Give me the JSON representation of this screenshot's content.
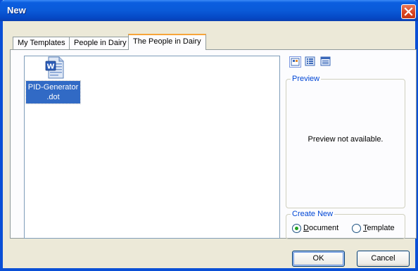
{
  "window": {
    "title": "New"
  },
  "tabs": [
    {
      "label": "My Templates",
      "active": false
    },
    {
      "label": "People in Dairy",
      "active": false
    },
    {
      "label": "The People in Dairy",
      "active": true
    }
  ],
  "files": [
    {
      "name_line1": "PID-Generator",
      "name_line2": ".dot",
      "icon": "word-template-icon",
      "selected": true
    }
  ],
  "view_buttons": [
    "large-icons-icon",
    "list-icon",
    "details-icon"
  ],
  "preview": {
    "legend": "Preview",
    "message": "Preview not available."
  },
  "create_new": {
    "legend": "Create New",
    "options": [
      {
        "label_first": "D",
        "label_rest": "ocument",
        "checked": true
      },
      {
        "label_first": "T",
        "label_rest": "emplate",
        "checked": false
      }
    ]
  },
  "buttons": {
    "ok": "OK",
    "cancel": "Cancel"
  },
  "colors": {
    "titlebar": "#0a5ad8",
    "selection": "#316ac5",
    "tab_highlight": "#f7a53a",
    "legend": "#0046d5"
  }
}
